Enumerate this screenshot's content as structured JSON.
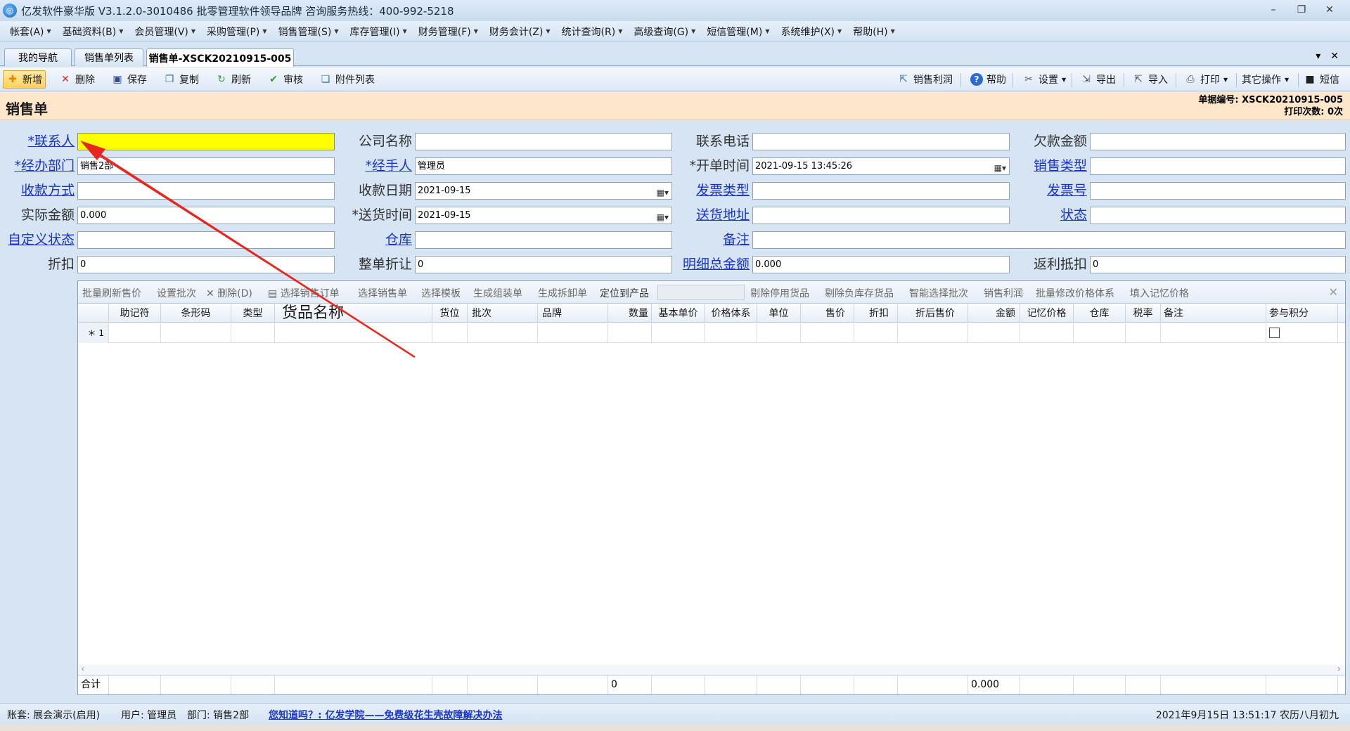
{
  "window": {
    "title": "亿发软件豪华版 V3.1.2.0-3010486 批零管理软件领导品牌 咨询服务热线：400-992-5218",
    "controls": [
      "–",
      "❐",
      "✕"
    ]
  },
  "menu": [
    "帐套(A)",
    "基础资料(B)",
    "会员管理(V)",
    "采购管理(P)",
    "销售管理(S)",
    "库存管理(I)",
    "财务管理(F)",
    "财务会计(Z)",
    "统计查询(R)",
    "高级查询(G)",
    "短信管理(M)",
    "系统维护(X)",
    "帮助(H)"
  ],
  "tabs": {
    "items": [
      "我的导航",
      "销售单列表",
      "销售单-XSCK20210915-005"
    ],
    "controls": [
      "▾",
      "✕"
    ]
  },
  "toolbar": {
    "new": "新增",
    "delete": "删除",
    "save": "保存",
    "copy": "复制",
    "refresh": "刷新",
    "audit": "审核",
    "attachments": "附件列表",
    "sales_profit": "销售利润",
    "help": "帮助",
    "settings": "设置",
    "export": "导出",
    "import": "导入",
    "print": "打印",
    "other_ops": "其它操作",
    "sms": "短信"
  },
  "page": {
    "title": "销售单",
    "doc_no_label": "单据编号:",
    "doc_no": "XSCK20210915-005",
    "print_count_label": "打印次数:",
    "print_count": "0次"
  },
  "form": {
    "contact": {
      "label": "*联系人",
      "value": ""
    },
    "company": {
      "label": "公司名称",
      "value": ""
    },
    "phone": {
      "label": "联系电话",
      "value": ""
    },
    "arrears": {
      "label": "欠款金额",
      "value": ""
    },
    "department": {
      "label": "*经办部门",
      "value": "销售2部"
    },
    "handler": {
      "label": "*经手人",
      "value": "管理员"
    },
    "order_time": {
      "label": "*开单时间",
      "value": "2021-09-15 13:45:26"
    },
    "sales_type": {
      "label": "销售类型",
      "value": ""
    },
    "payment_method": {
      "label": "收款方式",
      "value": ""
    },
    "payment_date": {
      "label": "收款日期",
      "value": "2021-09-15"
    },
    "invoice_type": {
      "label": "发票类型",
      "value": ""
    },
    "invoice_no": {
      "label": "发票号",
      "value": ""
    },
    "actual_amount": {
      "label": "实际金额",
      "value": "0.000"
    },
    "delivery_time": {
      "label": "*送货时间",
      "value": "2021-09-15"
    },
    "delivery_address": {
      "label": "送货地址",
      "value": ""
    },
    "status": {
      "label": "状态",
      "value": ""
    },
    "custom_status": {
      "label": "自定义状态",
      "value": ""
    },
    "warehouse": {
      "label": "仓库",
      "value": ""
    },
    "remark": {
      "label": "备注",
      "value": ""
    },
    "discount": {
      "label": "折扣",
      "value": "0"
    },
    "order_discount": {
      "label": "整单折让",
      "value": "0"
    },
    "detail_total": {
      "label": "明细总金额",
      "value": "0.000"
    },
    "rebate": {
      "label": "返利抵扣",
      "value": "0"
    }
  },
  "grid_toolbar": [
    "批量刷新售价",
    "设置批次",
    "删除(D)",
    "选择销售订单",
    "选择销售单",
    "选择模板",
    "生成组装单",
    "生成拆卸单",
    "定位到产品",
    "剔除停用货品",
    "剔除负库存货品",
    "智能选择批次",
    "销售利润",
    "批量修改价格体系",
    "填入记忆价格"
  ],
  "grid": {
    "columns": [
      "助记符",
      "条形码",
      "类型",
      "货品名称",
      "货位",
      "批次",
      "品牌",
      "数量",
      "基本单价",
      "价格体系",
      "单位",
      "售价",
      "折扣",
      "折后售价",
      "金额",
      "记忆价格",
      "仓库",
      "税率",
      "备注",
      "参与积分"
    ],
    "row_marker": "＊ 1",
    "footer_label": "合计",
    "footer_qty": "0",
    "footer_amount": "0.000"
  },
  "status": {
    "account": "账套: 展会演示(启用)",
    "user": "用户: 管理员",
    "dept": "部门: 销售2部",
    "tip": "您知道吗？: 亿发学院——免费级花生壳故障解决办法",
    "datetime": "2021年9月15日 13:51:17 农历八月初九"
  },
  "colors": {
    "required_highlight": "#ffff00",
    "link_label": "#1a35c8",
    "page_header_bg": "#fde6c9",
    "annotation_arrow": "#e8261e"
  },
  "icons": [
    "app-logo-icon",
    "new-icon",
    "delete-icon",
    "save-icon",
    "copy-icon",
    "refresh-icon",
    "check-icon",
    "attachment-icon",
    "profit-icon",
    "help-icon",
    "settings-icon",
    "export-icon",
    "import-icon",
    "print-icon",
    "sms-icon",
    "calendar-dropdown-icon"
  ]
}
